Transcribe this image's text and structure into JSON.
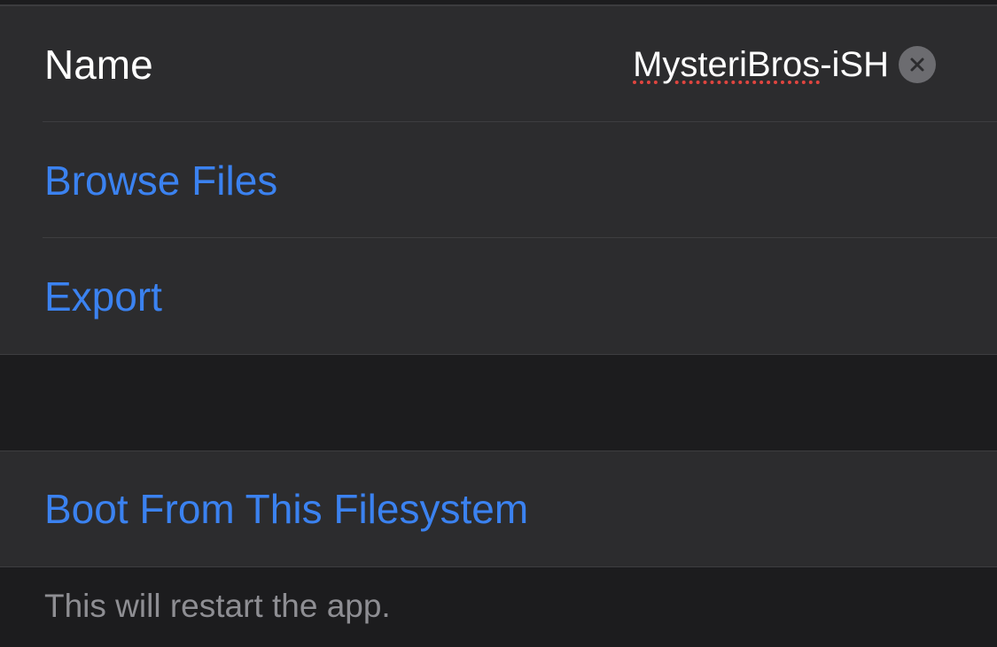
{
  "colors": {
    "background": "#1c1c1e",
    "cell": "#2c2c2e",
    "separator": "#3d3d40",
    "accent": "#3b82f0",
    "primary_text": "#ffffff",
    "secondary_text": "#8e8e93",
    "spellcheck": "#e0453f"
  },
  "name_row": {
    "label": "Name",
    "value_misspelled": "MysteriBros",
    "value_rest": "-iSH",
    "clear_icon": "clear-x-circle-icon"
  },
  "actions": {
    "browse_files": "Browse Files",
    "export": "Export",
    "boot": "Boot From This Filesystem"
  },
  "footer": {
    "text": "This will restart the app."
  }
}
